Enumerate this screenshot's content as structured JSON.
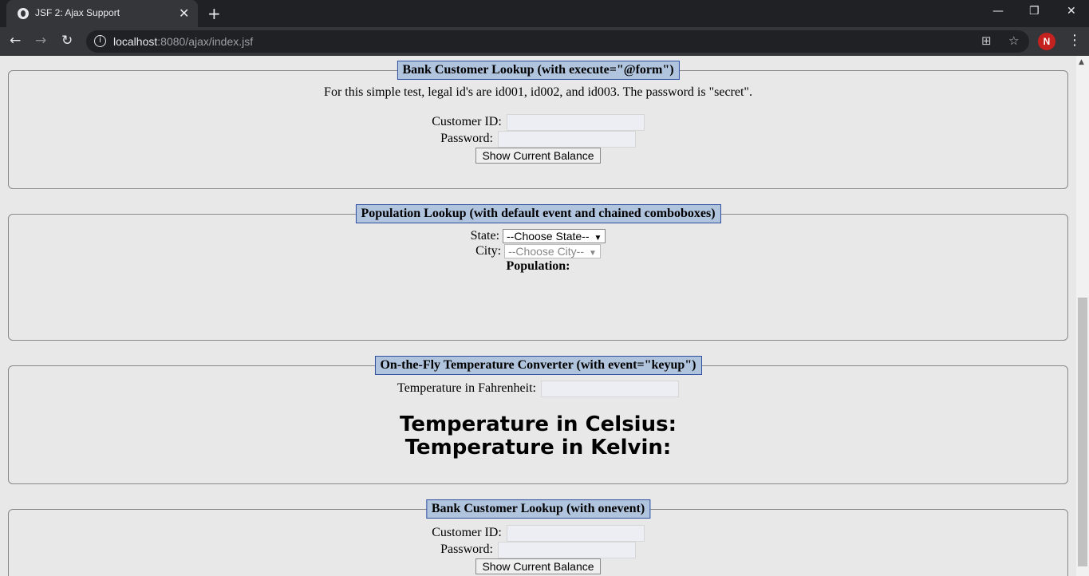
{
  "browser": {
    "tab_title": "JSF 2: Ajax Support",
    "url_host": "localhost",
    "url_rest": ":8080/ajax/index.jsf",
    "avatar_letter": "N"
  },
  "bank1": {
    "legend": "Bank Customer Lookup (with execute=\"@form\")",
    "note": "For this simple test, legal id's are id001, id002, and id003. The password is \"secret\".",
    "customer_label": "Customer ID:",
    "password_label": "Password:",
    "button": "Show Current Balance"
  },
  "population": {
    "legend": "Population Lookup (with default event and chained comboboxes)",
    "state_label": "State:",
    "state_value": "--Choose State--",
    "city_label": "City:",
    "city_value": "--Choose City--",
    "population_label": "Population:"
  },
  "temperature": {
    "legend": "On-the-Fly Temperature Converter (with event=\"keyup\")",
    "fahrenheit_label": "Temperature in Fahrenheit:",
    "celsius_label": "Temperature in Celsius:",
    "kelvin_label": "Temperature in Kelvin:"
  },
  "bank2": {
    "legend": "Bank Customer Lookup (with onevent)",
    "customer_label": "Customer ID:",
    "password_label": "Password:",
    "button": "Show Current Balance"
  }
}
